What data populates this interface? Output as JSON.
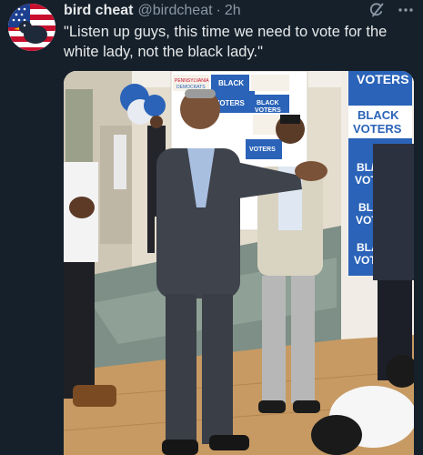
{
  "tweet": {
    "author_name": "bird cheat",
    "author_handle": "@birdcheat",
    "separator": "·",
    "timestamp": "2h",
    "text": "\"Listen up guys, this time we need to vote for the white lady, not the black lady.\""
  },
  "icons": {
    "grok": "grok-icon",
    "more": "more-icon",
    "avatar": "flag-bird-avatar"
  },
  "media": {
    "signs": [
      "VOTERS",
      "BLACK VOTERS",
      "BLACK",
      "VOTERS",
      "PENNSYLVANIA DEMOCRATS"
    ],
    "photo_signs": {
      "s1": "VOTERS",
      "s2": "BLACK",
      "s3": "VOTERS",
      "s4": "BL/",
      "s5": "VOT",
      "s6": "BL",
      "s7": "VOT",
      "s8": "BLA",
      "s9": "VOTE",
      "s10": "BLACK",
      "s11": "VOTERS",
      "s12": "BLACK",
      "s13": "VOTERS",
      "s14": "PENNSYLVANIA",
      "s15": "DEMOCRATS",
      "s16": "VOTERS"
    }
  },
  "colors": {
    "background": "#15202b",
    "secondary_text": "#8b98a5",
    "sign_blue": "#2a63b8"
  }
}
